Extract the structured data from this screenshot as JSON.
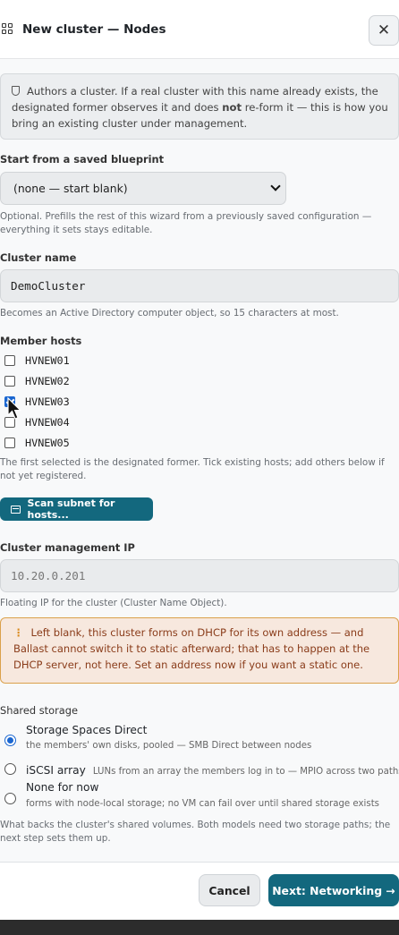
{
  "dialog": {
    "title": "New cluster — Nodes",
    "close_icon": "close-icon",
    "title_icon": "grid-icon"
  },
  "notice": {
    "icon": "shield-icon",
    "text_before": "Authors a cluster. If a real cluster with this name already exists, the designated former observes it and does ",
    "emphasis": "not",
    "text_after": " re-form it — this is how you bring an existing cluster under management."
  },
  "blueprint": {
    "label": "Start from a saved blueprint",
    "selected": "(none — start blank)",
    "help": "Optional. Prefills the rest of this wizard from a previously saved configuration — everything it sets stays editable."
  },
  "cluster_name": {
    "label": "Cluster name",
    "value": "DemoCluster",
    "help": "Becomes an Active Directory computer object, so 15 characters at most."
  },
  "member_hosts": {
    "label": "Member hosts",
    "hosts": [
      {
        "name": "HVNEW01",
        "checked": false
      },
      {
        "name": "HVNEW02",
        "checked": false
      },
      {
        "name": "HVNEW03",
        "checked": true
      },
      {
        "name": "HVNEW04",
        "checked": false
      },
      {
        "name": "HVNEW05",
        "checked": false
      }
    ],
    "help": "The first selected is the designated former. Tick existing hosts; add others below if not yet registered.",
    "scan_button": "Scan subnet for hosts...",
    "scan_icon": "server-icon"
  },
  "management_ip": {
    "label": "Cluster management IP",
    "placeholder": "10.20.0.201",
    "help": "Floating IP for the cluster (Cluster Name Object).",
    "warning": "Left blank, this cluster forms on DHCP for its own address — and Ballast cannot switch it to static afterward; that has to happen at the DHCP server, not here. Set an address now if you want a static one.",
    "warning_icon": "warning-icon"
  },
  "shared_storage": {
    "label": "Shared storage",
    "options": [
      {
        "title": "Storage Spaces Direct",
        "desc": "the members' own disks, pooled — SMB Direct between nodes",
        "selected": true
      },
      {
        "title": "iSCSI array",
        "desc": "LUNs from an array the members log in to — MPIO across two paths",
        "selected": false
      },
      {
        "title": "None for now",
        "desc": "forms with node-local storage; no VM can fail over until shared storage exists",
        "selected": false
      }
    ],
    "help": "What backs the cluster's shared volumes. Both models need two storage paths; the next step sets them up."
  },
  "footer": {
    "cancel": "Cancel",
    "next": "Next: Networking →"
  },
  "colors": {
    "accent": "#13687e",
    "checkbox_blue": "#1a66d0",
    "warning_bg": "#f7e8de",
    "warning_border": "#dba14b"
  }
}
